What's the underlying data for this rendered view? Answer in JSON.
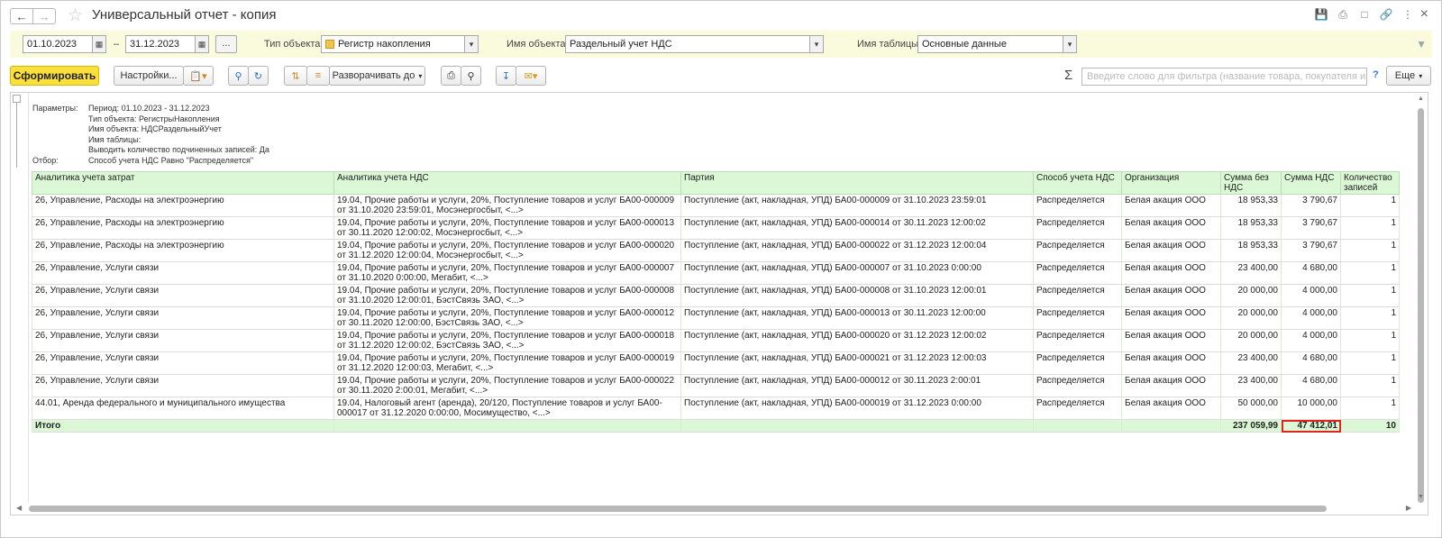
{
  "window": {
    "title": "Универсальный отчет - копия"
  },
  "params": {
    "date_from": "01.10.2023",
    "date_to": "31.12.2023",
    "dash": "–",
    "ellipsis": "...",
    "object_type_label": "Тип объекта:",
    "object_type_value": "Регистр накопления",
    "object_name_label": "Имя объекта:",
    "object_name_value": "Раздельный учет НДС",
    "table_name_label": "Имя таблицы:",
    "table_name_value": "Основные данные"
  },
  "toolbar": {
    "generate_label": "Сформировать",
    "settings_label": "Настройки...",
    "expand_label": "Разворачивать до",
    "search_placeholder": "Введите слово для фильтра (название товара, покупателя и пр.)",
    "help_label": "?",
    "more_label": "Еще"
  },
  "report_params": [
    {
      "key": "Параметры:",
      "value": "Период: 01.10.2023 - 31.12.2023"
    },
    {
      "key": "",
      "value": "Тип объекта: РегистрыНакопления"
    },
    {
      "key": "",
      "value": "Имя объекта: НДСРаздельныйУчет"
    },
    {
      "key": "",
      "value": "Имя таблицы:"
    },
    {
      "key": "",
      "value": "Выводить количество подчиненных записей: Да"
    },
    {
      "key": "Отбор:",
      "value": "Способ учета НДС Равно \"Распределяется\""
    }
  ],
  "table": {
    "columns": [
      "Аналитика учета затрат",
      "Аналитика учета НДС",
      "Партия",
      "Способ учета НДС",
      "Организация",
      "Сумма без НДС",
      "Сумма НДС",
      "Количество записей"
    ],
    "rows": [
      [
        "26, Управление, Расходы на электроэнергию",
        "19.04, Прочие работы и услуги, 20%, Поступление товаров и услуг БА00-000009 от 31.10.2020 23:59:01, Мосэнергосбыт, <...>",
        "Поступление (акт, накладная, УПД) БА00-000009 от 31.10.2023 23:59:01",
        "Распределяется",
        "Белая акация ООО",
        "18 953,33",
        "3 790,67",
        "1"
      ],
      [
        "26, Управление, Расходы на электроэнергию",
        "19.04, Прочие работы и услуги, 20%, Поступление товаров и услуг БА00-000013 от 30.11.2020 12:00:02, Мосэнергосбыт, <...>",
        "Поступление (акт, накладная, УПД) БА00-000014 от 30.11.2023 12:00:02",
        "Распределяется",
        "Белая акация ООО",
        "18 953,33",
        "3 790,67",
        "1"
      ],
      [
        "26, Управление, Расходы на электроэнергию",
        "19.04, Прочие работы и услуги, 20%, Поступление товаров и услуг БА00-000020 от 31.12.2020 12:00:04, Мосэнергосбыт, <...>",
        "Поступление (акт, накладная, УПД) БА00-000022 от 31.12.2023 12:00:04",
        "Распределяется",
        "Белая акация ООО",
        "18 953,33",
        "3 790,67",
        "1"
      ],
      [
        "26, Управление, Услуги связи",
        "19.04, Прочие работы и услуги, 20%, Поступление товаров и услуг БА00-000007 от 31.10.2020 0:00:00, Мегабит, <...>",
        "Поступление (акт, накладная, УПД) БА00-000007 от 31.10.2023 0:00:00",
        "Распределяется",
        "Белая акация ООО",
        "23 400,00",
        "4 680,00",
        "1"
      ],
      [
        "26, Управление, Услуги связи",
        "19.04, Прочие работы и услуги, 20%, Поступление товаров и услуг БА00-000008 от 31.10.2020 12:00:01, БэстСвязь ЗАО, <...>",
        "Поступление (акт, накладная, УПД) БА00-000008 от 31.10.2023 12:00:01",
        "Распределяется",
        "Белая акация ООО",
        "20 000,00",
        "4 000,00",
        "1"
      ],
      [
        "26, Управление, Услуги связи",
        "19.04, Прочие работы и услуги, 20%, Поступление товаров и услуг БА00-000012 от 30.11.2020 12:00:00, БэстСвязь ЗАО, <...>",
        "Поступление (акт, накладная, УПД) БА00-000013 от 30.11.2023 12:00:00",
        "Распределяется",
        "Белая акация ООО",
        "20 000,00",
        "4 000,00",
        "1"
      ],
      [
        "26, Управление, Услуги связи",
        "19.04, Прочие работы и услуги, 20%, Поступление товаров и услуг БА00-000018 от 31.12.2020 12:00:02, БэстСвязь ЗАО, <...>",
        "Поступление (акт, накладная, УПД) БА00-000020 от 31.12.2023 12:00:02",
        "Распределяется",
        "Белая акация ООО",
        "20 000,00",
        "4 000,00",
        "1"
      ],
      [
        "26, Управление, Услуги связи",
        "19.04, Прочие работы и услуги, 20%, Поступление товаров и услуг БА00-000019 от 31.12.2020 12:00:03, Мегабит, <...>",
        "Поступление (акт, накладная, УПД) БА00-000021 от 31.12.2023 12:00:03",
        "Распределяется",
        "Белая акация ООО",
        "23 400,00",
        "4 680,00",
        "1"
      ],
      [
        "26, Управление, Услуги связи",
        "19.04, Прочие работы и услуги, 20%, Поступление товаров и услуг БА00-000022 от 30.11.2020 2:00:01, Мегабит, <...>",
        "Поступление (акт, накладная, УПД) БА00-000012 от 30.11.2023 2:00:01",
        "Распределяется",
        "Белая акация ООО",
        "23 400,00",
        "4 680,00",
        "1"
      ],
      [
        "44.01, Аренда федерального и муниципального имущества",
        "19.04, Налоговый агент (аренда), 20/120, Поступление товаров и услуг БА00-000017 от 31.12.2020 0:00:00, Мосимущество, <...>",
        "Поступление (акт, накладная, УПД) БА00-000019 от 31.12.2023 0:00:00",
        "Распределяется",
        "Белая акация ООО",
        "50 000,00",
        "10 000,00",
        "1"
      ]
    ],
    "total": {
      "label": "Итого",
      "sum_without_vat": "237 059,99",
      "vat_sum": "47 412,01",
      "count": "10"
    }
  },
  "colors": {
    "accent_button": "#fbe03c",
    "table_header": "#dbf7d5",
    "highlight": "#e0251c",
    "params_bg": "#fafadc"
  }
}
